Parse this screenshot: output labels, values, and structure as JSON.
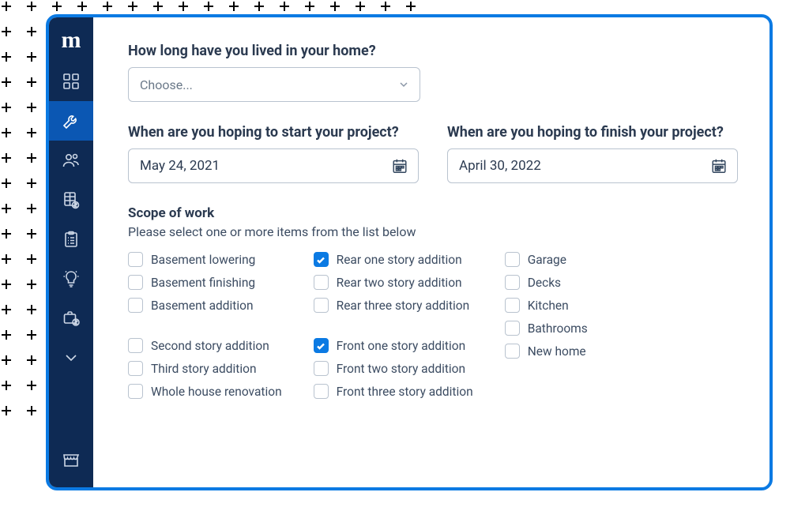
{
  "brand": {
    "logo_letter": "m"
  },
  "sidebar": {
    "items": [
      {
        "name": "dashboard",
        "active": false
      },
      {
        "name": "tools",
        "active": true
      },
      {
        "name": "people",
        "active": false
      },
      {
        "name": "pricing",
        "active": false
      },
      {
        "name": "clipboard",
        "active": false
      },
      {
        "name": "idea",
        "active": false
      },
      {
        "name": "shopping-finance",
        "active": false
      },
      {
        "name": "more",
        "active": false
      }
    ],
    "footer_item": {
      "name": "storefront"
    }
  },
  "form": {
    "q1_label": "How long have you lived in your home?",
    "q1_placeholder": "Choose...",
    "q2_label": "When are you hoping to start your project?",
    "q2_value": "May 24, 2021",
    "q3_label": "When are you hoping to finish your project?",
    "q3_value": "April 30, 2022",
    "scope_title": "Scope of work",
    "scope_subtitle": "Please select one or more items from the list below",
    "scope": {
      "col1": {
        "groupA": [
          {
            "label": "Basement lowering",
            "checked": false
          },
          {
            "label": "Basement finishing",
            "checked": false
          },
          {
            "label": "Basement addition",
            "checked": false
          }
        ],
        "groupB": [
          {
            "label": "Second story addition",
            "checked": false
          },
          {
            "label": "Third story addition",
            "checked": false
          },
          {
            "label": "Whole house renovation",
            "checked": false
          }
        ]
      },
      "col2": {
        "groupA": [
          {
            "label": "Rear one story addition",
            "checked": true
          },
          {
            "label": "Rear two story addition",
            "checked": false
          },
          {
            "label": "Rear three story addition",
            "checked": false
          }
        ],
        "groupB": [
          {
            "label": "Front one story addition",
            "checked": true
          },
          {
            "label": "Front two story addition",
            "checked": false
          },
          {
            "label": "Front three story addition",
            "checked": false
          }
        ]
      },
      "col3": {
        "groupA": [
          {
            "label": "Garage",
            "checked": false
          },
          {
            "label": "Decks",
            "checked": false
          },
          {
            "label": "Kitchen",
            "checked": false
          },
          {
            "label": "Bathrooms",
            "checked": false
          },
          {
            "label": "New home",
            "checked": false
          }
        ]
      }
    }
  }
}
